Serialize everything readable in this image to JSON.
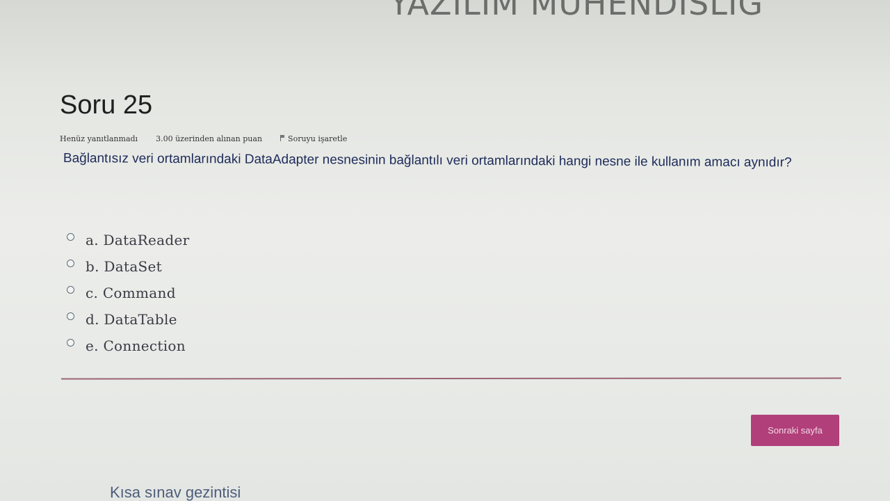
{
  "header": {
    "banner_text": "YAZILIM MÜHENDİSLİĞ"
  },
  "question": {
    "title": "Soru 25",
    "status": "Henüz yanıtlanmadı",
    "score": "3.00 üzerinden alınan puan",
    "flag_label": "Soruyu işaretle",
    "text": "Bağlantısız veri ortamlarındaki DataAdapter nesnesinin bağlantılı veri ortamlarındaki hangi nesne ile kullanım amacı aynıdır?"
  },
  "answers": [
    {
      "label": "a. DataReader"
    },
    {
      "label": "b. DataSet"
    },
    {
      "label": "c. Command"
    },
    {
      "label": "d. DataTable"
    },
    {
      "label": "e. Connection"
    }
  ],
  "navigation": {
    "next_button": "Sonraki sayfa",
    "quiz_nav_title": "Kısa sınav gezintisi"
  },
  "colors": {
    "accent": "#b03f7a",
    "divider": "#9a6478",
    "question_text": "#1e2b5a"
  }
}
